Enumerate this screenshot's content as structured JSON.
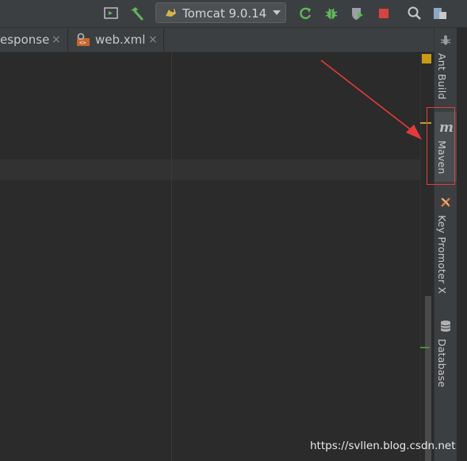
{
  "toolbar": {
    "run_config": "Tomcat 9.0.14",
    "icons": [
      "layout-icon",
      "build-hammer-icon",
      "tomcat-icon",
      "dropdown-caret-icon",
      "rerun-icon",
      "debug-bug-icon",
      "coverage-icon",
      "stop-icon",
      "search-icon",
      "project-structure-icon"
    ]
  },
  "tabs": [
    {
      "label": "esponse",
      "close": "×"
    },
    {
      "label": "web.xml",
      "close": "×"
    }
  ],
  "tool_windows": [
    {
      "label": "Ant Build",
      "icon": "ant-icon"
    },
    {
      "label": "Maven",
      "icon": "maven-icon",
      "glyph": "m"
    },
    {
      "label": "Key Promoter X",
      "icon": "key-promoter-icon"
    },
    {
      "label": "Database",
      "icon": "database-icon"
    }
  ],
  "watermark": "https://svllen.blog.csdn.net",
  "colors": {
    "annotation_red": "#e63a3a",
    "inspection_yellow": "#c99b15",
    "maven_glyph": "#bbbbbb"
  }
}
